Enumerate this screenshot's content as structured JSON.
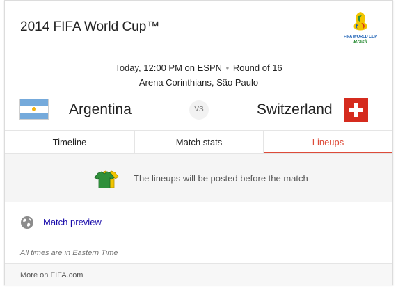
{
  "card": {
    "title": "2014 FIFA World Cup™",
    "logo": {
      "icon": "fifa-world-cup-2014-logo-icon",
      "line1": "FIFA WORLD CUP",
      "line2": "Brasil"
    }
  },
  "match": {
    "time": "Today, 12:00 PM on ESPN",
    "separator": "•",
    "round": "Round of 16",
    "venue": "Arena Corinthians, São Paulo",
    "vs_label": "VS",
    "home": {
      "name": "Argentina",
      "flag_icon": "argentina-flag-icon"
    },
    "away": {
      "name": "Switzerland",
      "flag_icon": "switzerland-flag-icon"
    }
  },
  "tabs": [
    {
      "label": "Timeline",
      "active": false
    },
    {
      "label": "Match stats",
      "active": false
    },
    {
      "label": "Lineups",
      "active": true
    }
  ],
  "lineups": {
    "icon": "jerseys-icon",
    "message": "The lineups will be posted before the match"
  },
  "preview": {
    "icon": "globe-icon",
    "label": "Match preview"
  },
  "note": "All times are in Eastern Time",
  "footer": {
    "link": "More on FIFA.com"
  },
  "colors": {
    "accent": "#dd4b39",
    "link": "#1a0dab",
    "argentina_blue": "#75aadb",
    "switzerland_red": "#d52b1e",
    "jersey_green": "#2f8f3a",
    "jersey_yellow": "#f2c500"
  }
}
